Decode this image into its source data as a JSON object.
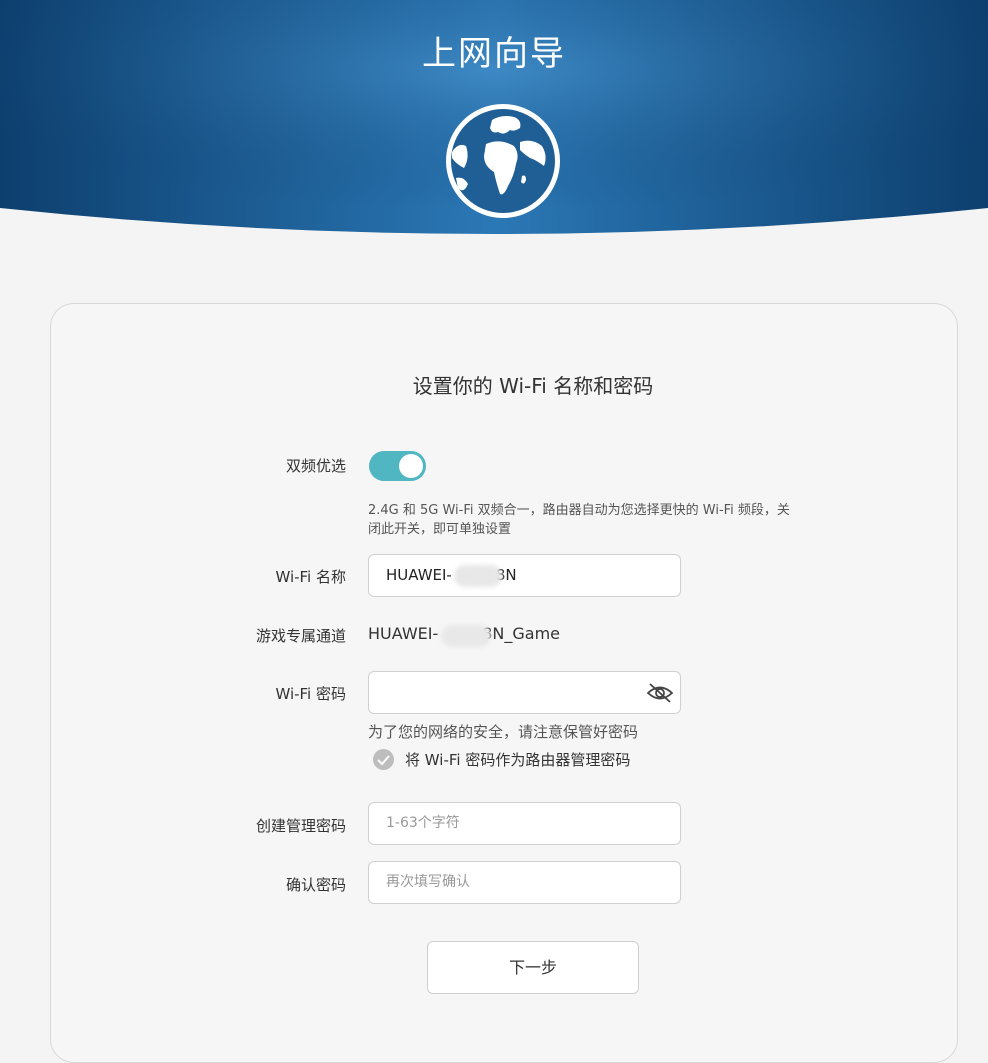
{
  "header": {
    "title": "上网向导",
    "colors": {
      "dark": "#0b3e6a",
      "light": "#2b7bb9"
    }
  },
  "form": {
    "title": "设置你的 Wi-Fi 名称和密码",
    "dual_band": {
      "label": "双频优选",
      "enabled": true,
      "hint": "2.4G 和 5G Wi-Fi 双频合一，路由器自动为您选择更快的 Wi-Fi 频段，关闭此开关，即可单独设置"
    },
    "wifi_name": {
      "label": "Wi-Fi 名称",
      "value_prefix": "HUAWEI-",
      "value_suffix": "8N"
    },
    "game_channel": {
      "label": "游戏专属通道",
      "value_prefix": "HUAWEI-",
      "value_suffix": "8N_Game"
    },
    "wifi_password": {
      "label": "Wi-Fi 密码",
      "value": "",
      "hint": "为了您的网络的安全，请注意保管好密码",
      "icon": "eye-hidden-icon"
    },
    "use_as_admin": {
      "label": "将 Wi-Fi 密码作为路由器管理密码",
      "checked": false
    },
    "admin_password": {
      "label": "创建管理密码",
      "placeholder": "1-63个字符"
    },
    "confirm_password": {
      "label": "确认密码",
      "placeholder": "再次填写确认"
    },
    "next_button": "下一步"
  }
}
